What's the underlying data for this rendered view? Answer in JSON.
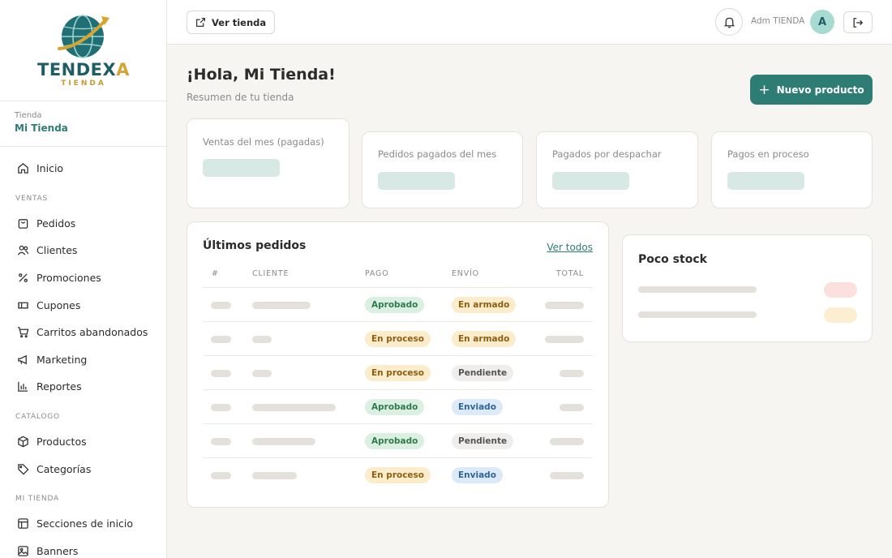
{
  "brand": {
    "name_main": "TENDEX",
    "name_accent": "A",
    "sub": "TIENDA"
  },
  "store": {
    "label": "Tienda",
    "name": "Mi Tienda"
  },
  "nav": {
    "home": "Inicio",
    "section_sales": "VENTAS",
    "orders": "Pedidos",
    "clients": "Clientes",
    "promotions": "Promociones",
    "coupons": "Cupones",
    "carts": "Carritos abandonados",
    "marketing": "Marketing",
    "reports": "Reportes",
    "section_catalog": "CATÁLOGO",
    "products": "Productos",
    "categories": "Categorías",
    "section_store": "MI TIENDA",
    "home_sections": "Secciones de inicio",
    "banners": "Banners"
  },
  "topbar": {
    "view_store": "Ver tienda",
    "admin_label": "Adm TIENDA",
    "avatar_initial": "A"
  },
  "header": {
    "greeting": "¡Hola, Mi Tienda!",
    "subtitle": "Resumen de tu tienda",
    "new_product": "Nuevo producto"
  },
  "stats": [
    {
      "label": "Ventas del mes (pagadas)"
    },
    {
      "label": "Pedidos pagados del mes"
    },
    {
      "label": "Pagados por despachar"
    },
    {
      "label": "Pagos en proceso"
    }
  ],
  "orders": {
    "title": "Últimos pedidos",
    "view_all": "Ver todos",
    "columns": {
      "num": "#",
      "client": "CLIENTE",
      "payment": "PAGO",
      "shipping": "ENVÍO",
      "total": "TOTAL"
    },
    "rows": [
      {
        "payment": "Aprobado",
        "shipping": "En armado"
      },
      {
        "payment": "En proceso",
        "shipping": "En armado"
      },
      {
        "payment": "En proceso",
        "shipping": "Pendiente"
      },
      {
        "payment": "Aprobado",
        "shipping": "Enviado"
      },
      {
        "payment": "Aprobado",
        "shipping": "Pendiente"
      },
      {
        "payment": "En proceso",
        "shipping": "Enviado"
      }
    ]
  },
  "low_stock": {
    "title": "Poco stock"
  },
  "colors": {
    "accent": "#2e7d75",
    "brand_gold": "#d4a533"
  }
}
